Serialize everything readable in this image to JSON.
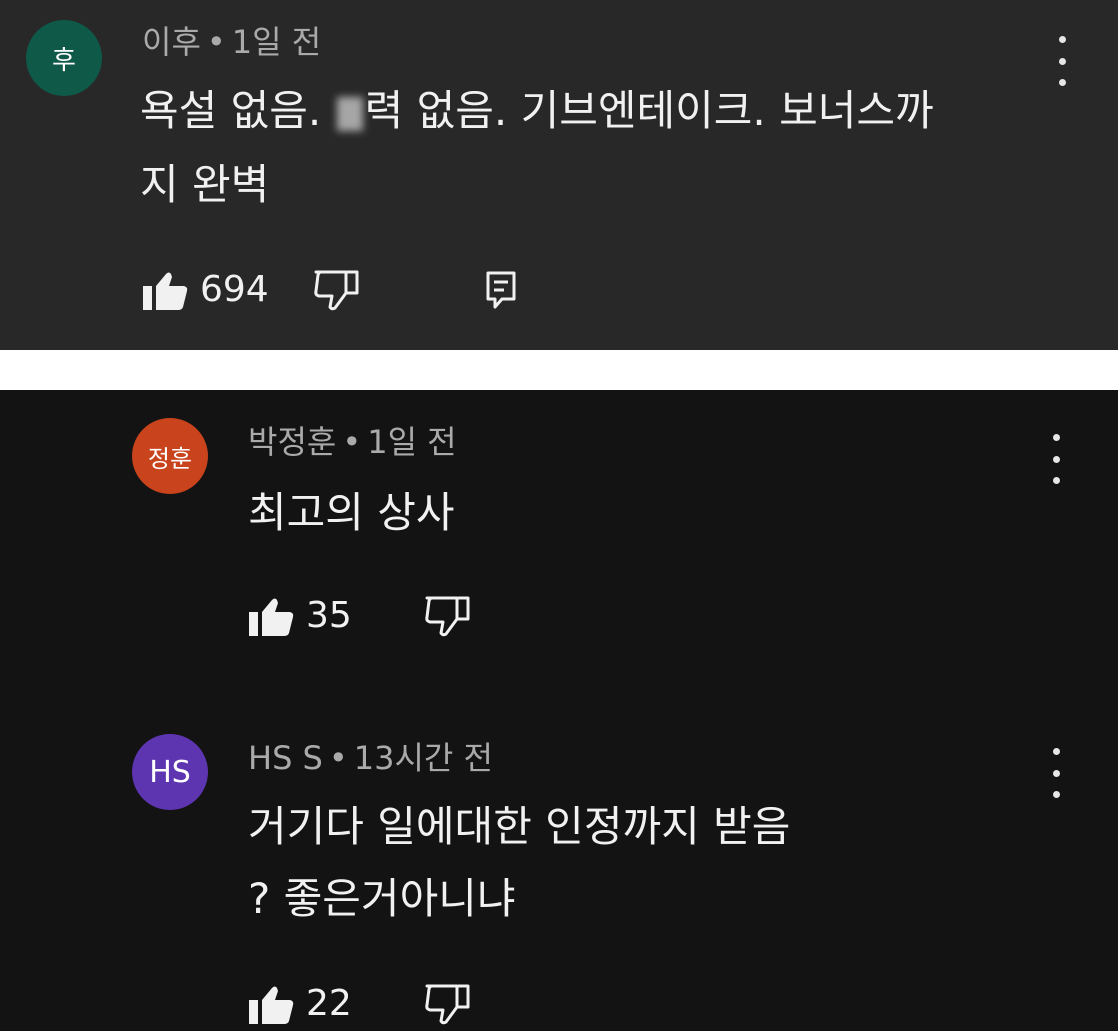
{
  "comments": [
    {
      "avatar_text": "후",
      "avatar_color": "#0f5948",
      "author": "이후",
      "time": "1일 전",
      "separator": "•",
      "text_line1_a": "욕설 없음.",
      "text_line1_b": "력 없음. 기브엔테이크. 보너스까",
      "text_line2": "지 완벽",
      "likes": "694",
      "icons": [
        "thumbs-up-icon",
        "thumbs-down-icon",
        "reply-icon",
        "more-vert-icon"
      ]
    },
    {
      "avatar_text": "정훈",
      "avatar_color": "#c9431c",
      "author": "박정훈",
      "time": "1일 전",
      "separator": "•",
      "text_line1": "최고의 상사",
      "likes": "35",
      "icons": [
        "thumbs-up-icon",
        "thumbs-down-icon",
        "more-vert-icon"
      ]
    },
    {
      "avatar_text": "HS",
      "avatar_color": "#5e35b1",
      "author": "HS S",
      "time": "13시간 전",
      "separator": "•",
      "text_line1": "거기다 일에대한 인정까지 받음",
      "text_line2": "? 좋은거아니냐",
      "likes": "22",
      "icons": [
        "thumbs-up-icon",
        "thumbs-down-icon",
        "more-vert-icon"
      ]
    }
  ],
  "colors": {
    "top_panel_bg": "#282828",
    "bottom_panel_bg": "#131313",
    "meta_text": "#aaaaaa",
    "body_text": "#f1f1f1"
  }
}
